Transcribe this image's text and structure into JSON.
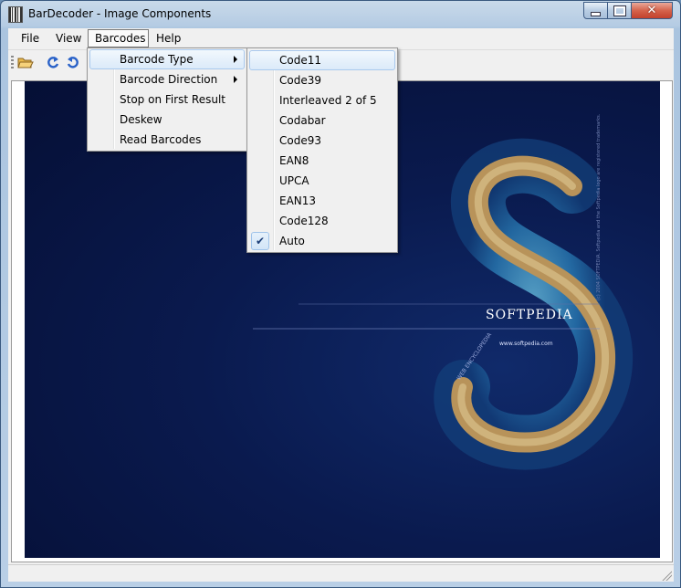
{
  "window": {
    "title": "BarDecoder - Image Components",
    "close_glyph": "✕"
  },
  "menubar": {
    "items": [
      {
        "label": "File"
      },
      {
        "label": "View"
      },
      {
        "label": "Barcodes"
      },
      {
        "label": "Help"
      }
    ]
  },
  "toolbar": {
    "buttons": [
      {
        "icon": "open-folder-icon"
      },
      {
        "icon": "rotate-right-icon"
      },
      {
        "icon": "rotate-left-icon"
      }
    ]
  },
  "barcodes_menu": {
    "items": [
      {
        "label": "Barcode Type"
      },
      {
        "label": "Barcode Direction"
      },
      {
        "label": "Stop on First Result"
      },
      {
        "label": "Deskew"
      },
      {
        "label": "Read Barcodes"
      }
    ]
  },
  "barcode_type_menu": {
    "items": [
      {
        "label": "Code11"
      },
      {
        "label": "Code39"
      },
      {
        "label": "Interleaved 2 of 5"
      },
      {
        "label": "Codabar"
      },
      {
        "label": "Code93"
      },
      {
        "label": "EAN8"
      },
      {
        "label": "UPCA"
      },
      {
        "label": "EAN13"
      },
      {
        "label": "Code128"
      },
      {
        "label": "Auto",
        "check": "✔"
      }
    ]
  },
  "image": {
    "brand_text": "SOFTPEDIA",
    "url_text": "www.softpedia.com",
    "web_text": "WEB ENCYCLOPEDIA",
    "copyright_text": "(c) 2004 SOFTPEDIA. Softpedia and the Softpedia logo are registered trademarks."
  },
  "colors": {
    "titlebar": "#b9cfe6",
    "menu_highlight": "#dbeaf9",
    "image_background": "#0a1a4e"
  }
}
